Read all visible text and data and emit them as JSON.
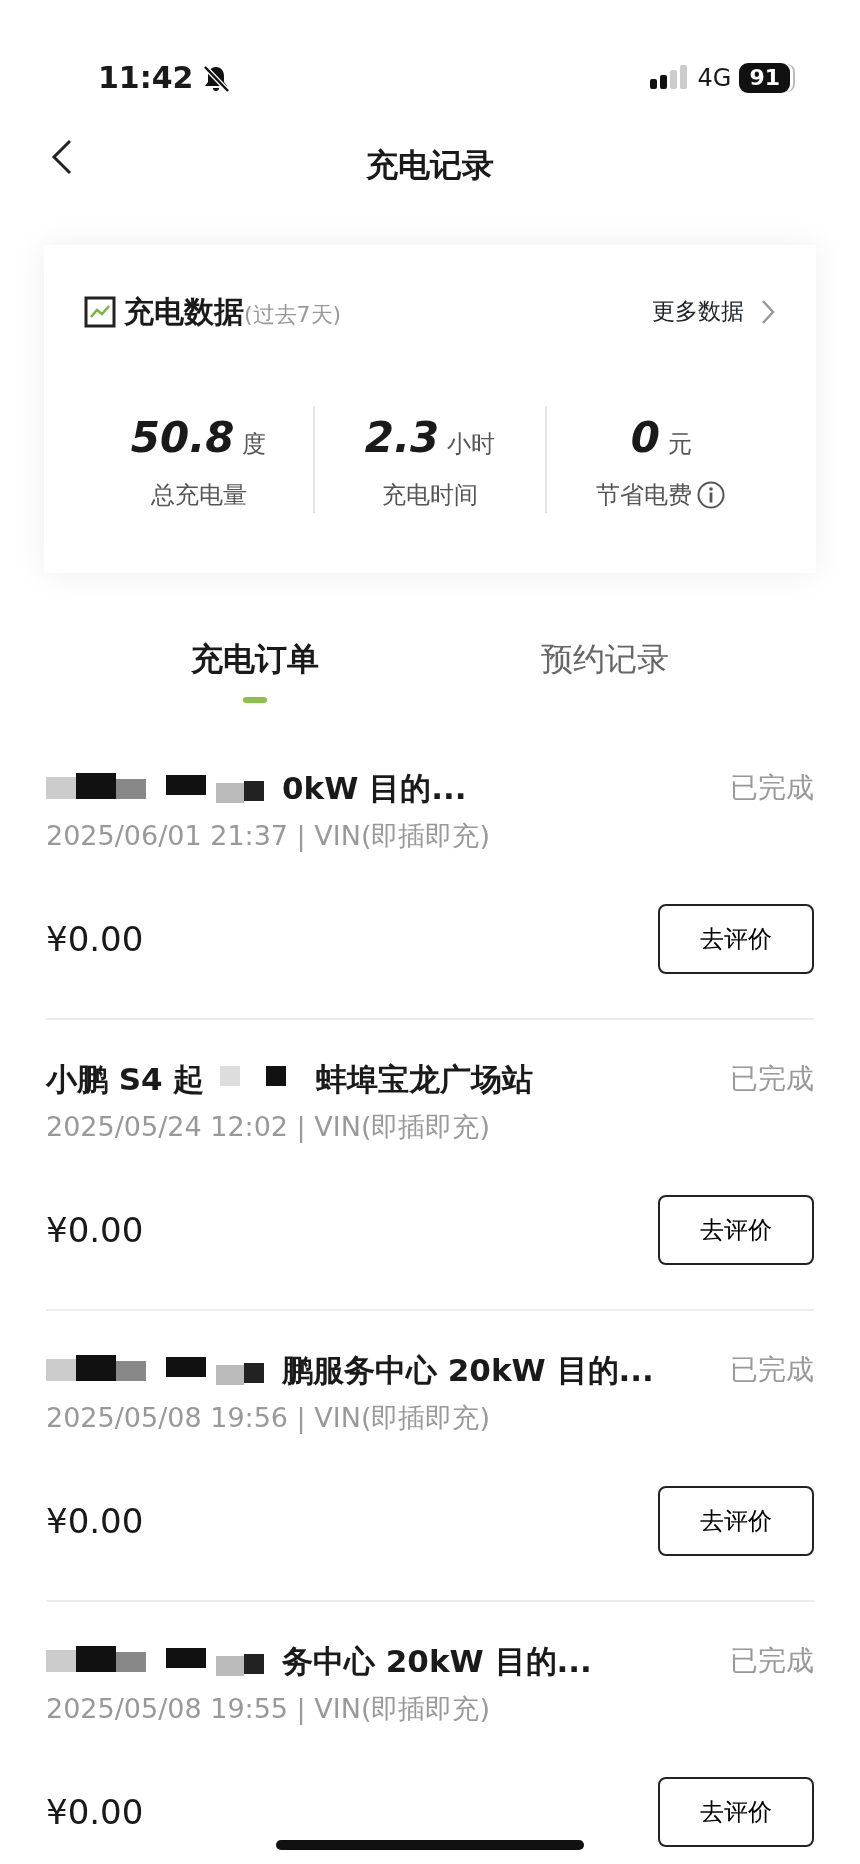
{
  "status_bar": {
    "time": "11:42",
    "network": "4G",
    "battery": "91"
  },
  "header": {
    "title": "充电记录"
  },
  "summary": {
    "title": "充电数据",
    "period": "(过去7天)",
    "more": "更多数据",
    "stats": [
      {
        "value": "50.8",
        "unit": "度",
        "label": "总充电量",
        "info": false
      },
      {
        "value": "2.3",
        "unit": "小时",
        "label": "充电时间",
        "info": false
      },
      {
        "value": "0",
        "unit": "元",
        "label": "节省电费",
        "info": true
      }
    ]
  },
  "tabs": [
    {
      "label": "充电订单",
      "selected": true
    },
    {
      "label": "预约记录",
      "selected": false
    }
  ],
  "orders": [
    {
      "title": "0kW 目的...",
      "redacted": true,
      "meta": "2025/06/01  21:37 | VIN(即插即充)",
      "price": "¥0.00",
      "status": "已完成",
      "action": "去评价"
    },
    {
      "title_prefix": "小鹏 S4 起",
      "title": "蚌埠宝龙广场站",
      "redacted": true,
      "meta": "2025/05/24  12:02 | VIN(即插即充)",
      "price": "¥0.00",
      "status": "已完成",
      "action": "去评价"
    },
    {
      "title": "鹏服务中心 20kW 目的...",
      "redacted": true,
      "meta": "2025/05/08  19:56 | VIN(即插即充)",
      "price": "¥0.00",
      "status": "已完成",
      "action": "去评价"
    },
    {
      "title": "务中心 20kW 目的...",
      "redacted": true,
      "meta": "2025/05/08  19:55 | VIN(即插即充)",
      "price": "¥0.00",
      "status": "已完成",
      "action": "去评价"
    }
  ]
}
